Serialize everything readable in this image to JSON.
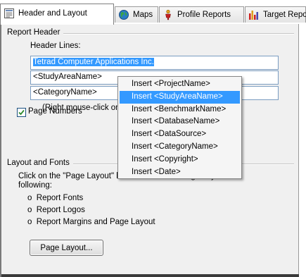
{
  "tabs": [
    {
      "label": "Header and Layout",
      "icon": "page-layout-icon",
      "active": true
    },
    {
      "label": "Maps",
      "icon": "globe-icon"
    },
    {
      "label": "Profile Reports",
      "icon": "figure-icon"
    },
    {
      "label": "Target Reports",
      "icon": "bar-chart-icon"
    }
  ],
  "report_header": {
    "group_title": "Report Header",
    "lines_label": "Header Lines:",
    "lines": [
      {
        "value": "Tetrad Computer Applications Inc.",
        "selected": true
      },
      {
        "value": "<StudyAreaName>"
      },
      {
        "value": "<CategoryName>"
      }
    ],
    "hint": "(Right mouse-click on h"
  },
  "page_numbers": {
    "label": "Page Numbers",
    "checked": true
  },
  "layout_fonts": {
    "group_title": "Layout and Fonts",
    "desc_line1": "Click on the \"Page Layout\" button below to change any of the",
    "desc_line2": "following:",
    "items": [
      "Report Fonts",
      "Report Logos",
      "Report Margins and Page Layout"
    ],
    "bullet": "o",
    "button_label": "Page Layout..."
  },
  "context_menu": {
    "items": [
      "Insert <ProjectName>",
      "Insert <StudyAreaName>",
      "Insert <BenchmarkName>",
      "Insert <DatabaseName>",
      "Insert <DataSource>",
      "Insert <CategoryName>",
      "Insert <Copyright>",
      "Insert <Date>"
    ],
    "highlighted_index": 1
  },
  "colors": {
    "selection": "#3399ff",
    "panel_bg": "#f0f0f0",
    "field_border": "#7a9cc0",
    "check_mark": "#2d8a2d"
  }
}
